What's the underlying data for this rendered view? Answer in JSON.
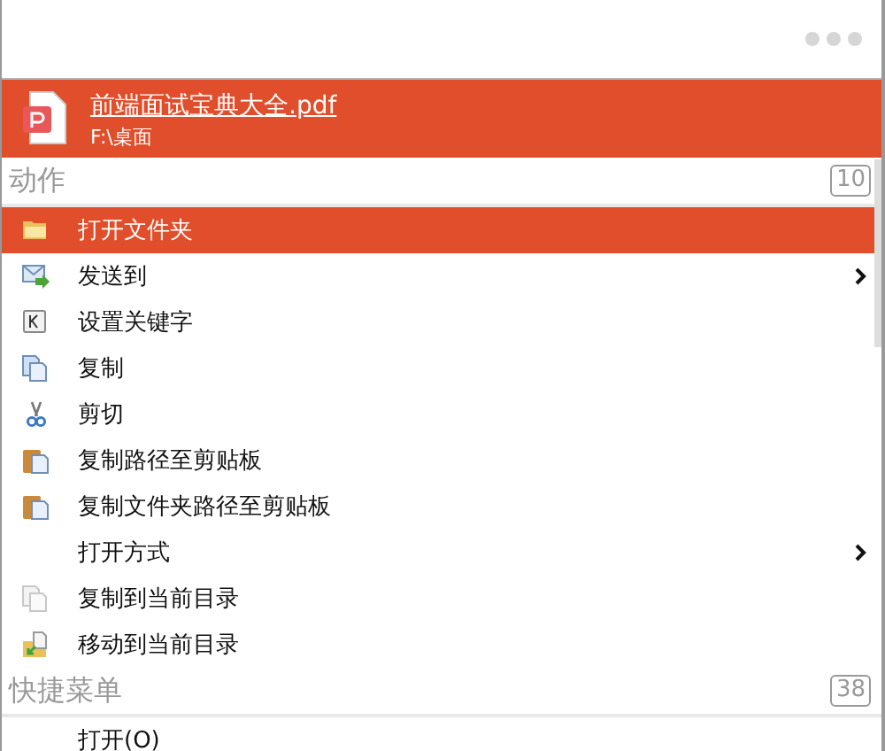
{
  "file": {
    "name": "前端面试宝典大全.pdf",
    "path": "F:\\桌面"
  },
  "sections": [
    {
      "title": "动作",
      "count": "10",
      "items": [
        {
          "label": "打开文件夹",
          "kind": "folder",
          "submenu": false,
          "selected": true
        },
        {
          "label": "发送到",
          "kind": "send",
          "submenu": true,
          "selected": false
        },
        {
          "label": "设置关键字",
          "kind": "key",
          "submenu": false,
          "selected": false
        },
        {
          "label": "复制",
          "kind": "copy",
          "submenu": false,
          "selected": false
        },
        {
          "label": "剪切",
          "kind": "cut",
          "submenu": false,
          "selected": false
        },
        {
          "label": "复制路径至剪贴板",
          "kind": "clipboard",
          "submenu": false,
          "selected": false
        },
        {
          "label": "复制文件夹路径至剪贴板",
          "kind": "clipboard",
          "submenu": false,
          "selected": false
        },
        {
          "label": "打开方式",
          "kind": "plain",
          "submenu": true,
          "selected": false
        },
        {
          "label": "复制到当前目录",
          "kind": "copy-faint",
          "submenu": false,
          "selected": false
        },
        {
          "label": "移动到当前目录",
          "kind": "move",
          "submenu": false,
          "selected": false
        }
      ]
    },
    {
      "title": "快捷菜单",
      "count": "38",
      "items": [
        {
          "label": "打开(O)",
          "kind": "plain",
          "submenu": false,
          "selected": false
        }
      ]
    }
  ]
}
